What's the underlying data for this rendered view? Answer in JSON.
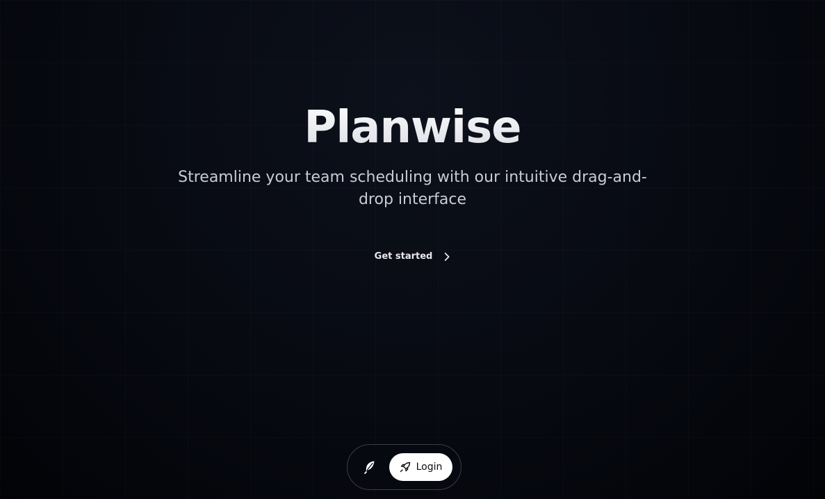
{
  "hero": {
    "title": "Planwise",
    "subtitle": "Streamline your team scheduling with our intuitive drag-and-drop interface",
    "cta_label": "Get started",
    "cta_icon": "chevron-right-icon"
  },
  "dock": {
    "logo_icon": "feather-icon",
    "login_label": "Login",
    "login_icon": "rocket-icon"
  },
  "colors": {
    "background": "#05070d",
    "title": "#ffffff",
    "subtitle": "#c9ccd4",
    "login_button_bg": "#ffffff",
    "dock_border": "#3a3d45"
  }
}
